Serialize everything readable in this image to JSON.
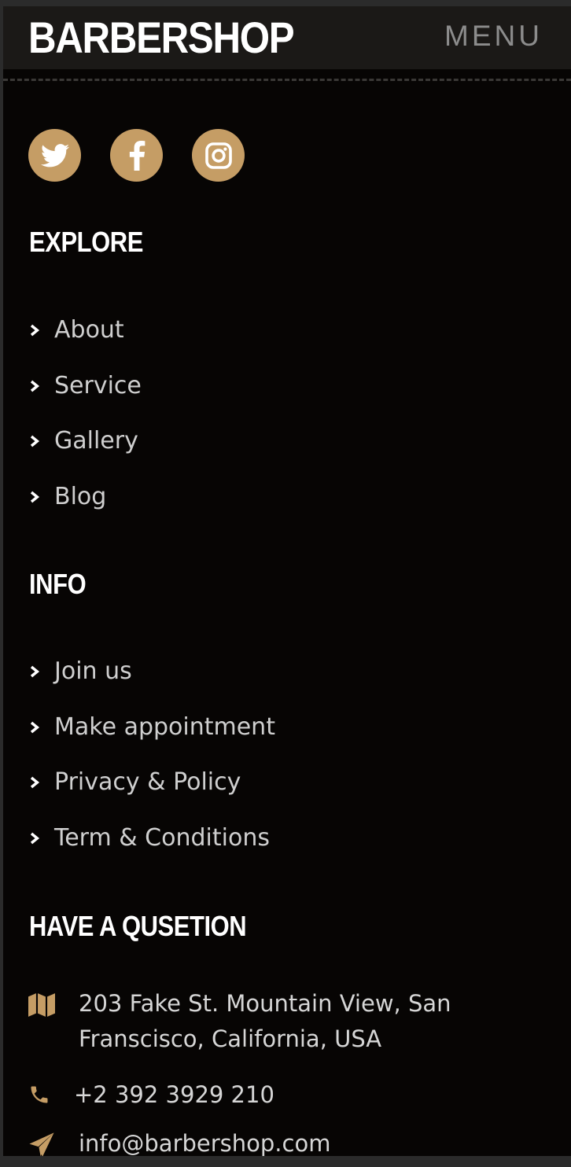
{
  "header": {
    "brand": "BARBERSHOP",
    "menu_label": "MENU"
  },
  "social": [
    {
      "icon": "twitter-icon"
    },
    {
      "icon": "facebook-icon"
    },
    {
      "icon": "instagram-icon"
    }
  ],
  "explore": {
    "title": "EXPLORE",
    "items": [
      "About",
      "Service",
      "Gallery",
      "Blog"
    ]
  },
  "info": {
    "title": "INFO",
    "items": [
      "Join us",
      "Make appointment",
      "Privacy & Policy",
      "Term & Conditions"
    ]
  },
  "contact": {
    "title": "HAVE A QUSETION",
    "address_line1": "203 Fake St. Mountain View, San",
    "address_line2": "Franscisco, California, USA",
    "phone": "+2 392 3929 210",
    "email": "info@barbershop.com"
  },
  "colors": {
    "accent": "#c59d65",
    "background": "#070504",
    "header_bg": "#1b1917",
    "text": "#cfcfcf"
  }
}
